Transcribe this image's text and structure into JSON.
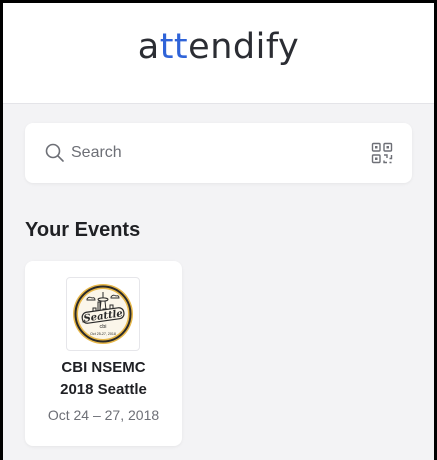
{
  "header": {
    "logo_prefix": "a",
    "logo_accent": "tt",
    "logo_suffix": "endify",
    "accent_color": "#2f63d8"
  },
  "search": {
    "placeholder": "Search",
    "icon": "search-icon",
    "qr_icon": "qr-code-icon"
  },
  "events_section": {
    "title": "Your Events",
    "events": [
      {
        "name_line1": "CBI NSEMC",
        "name_line2": "2018 Seattle",
        "dates": "Oct 24 – 27, 2018",
        "logo": {
          "word": "Seattle",
          "org": "cbi",
          "dates": "Oct 25-27, 2018"
        }
      }
    ]
  }
}
